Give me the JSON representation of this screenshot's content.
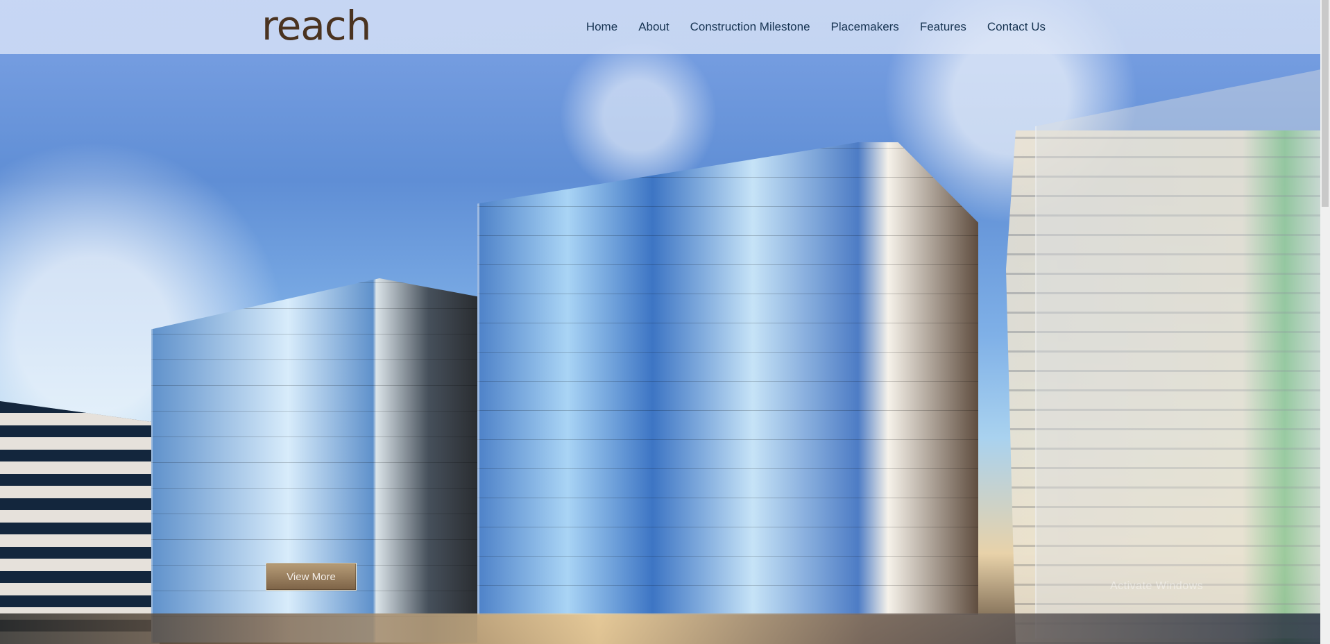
{
  "brand": {
    "logo_text": "reach"
  },
  "nav": {
    "items": [
      "Home",
      "About",
      "Construction Milestone",
      "Placemakers",
      "Features",
      "Contact Us"
    ]
  },
  "hero": {
    "button_label": "View More",
    "watermark": "Activate Windows"
  }
}
